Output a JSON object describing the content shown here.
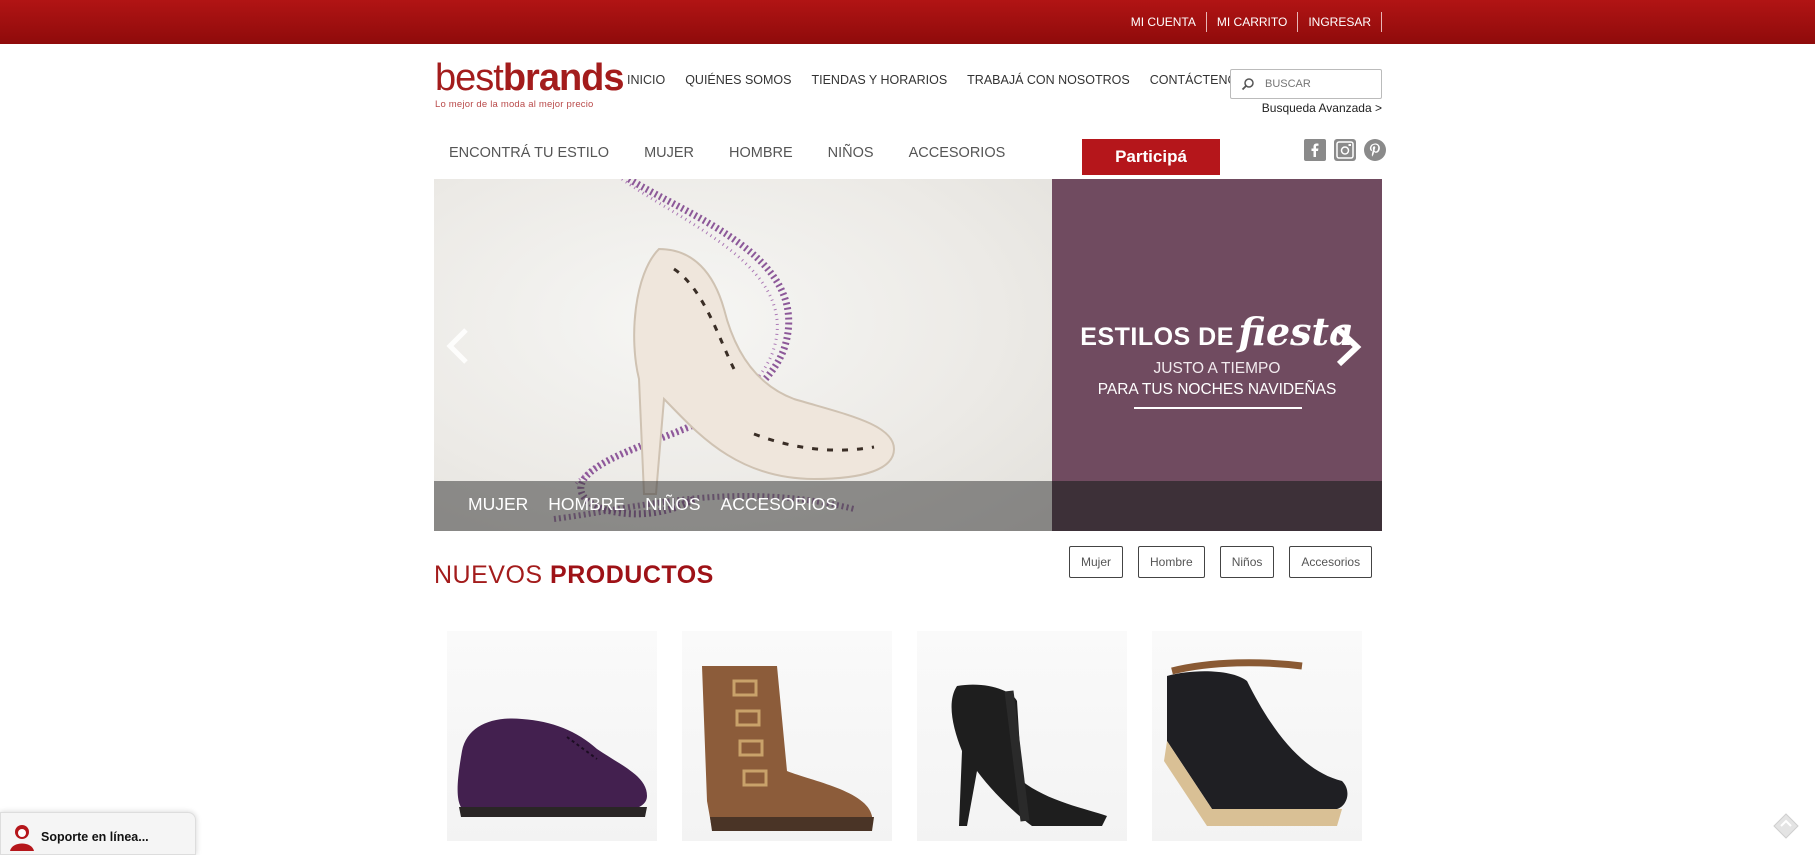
{
  "topbar": {
    "links": [
      "MI CUENTA",
      "MI CARRITO",
      "INGRESAR"
    ]
  },
  "logo": {
    "word_best": "best",
    "word_brands": "brands",
    "tagline": "Lo mejor de la moda al mejor precio"
  },
  "main_nav": [
    "INICIO",
    "QUIÉNES SOMOS",
    "TIENDAS Y HORARIOS",
    "TRABAJÁ CON NOSOTROS",
    "CONTÁCTENOS"
  ],
  "search": {
    "placeholder": "BUSCAR",
    "advanced_label": "Busqueda Avanzada >"
  },
  "category_nav": [
    "ENCONTRÁ TU ESTILO",
    "MUJER",
    "HOMBRE",
    "NIÑOS",
    "ACCESORIOS"
  ],
  "participa_label": "Participá",
  "social_icons": [
    "facebook-icon",
    "instagram-icon",
    "pinterest-icon"
  ],
  "hero": {
    "title_plain": "ESTILOS DE",
    "title_script": "fiesta",
    "subtitle_1": "JUSTO A TIEMPO",
    "subtitle_2": "PARA TUS NOCHES NAVIDEÑAS",
    "categories": [
      "MUJER",
      "HOMBRE",
      "NIÑOS",
      "ACCESORIOS"
    ],
    "panel_color": "#704b60"
  },
  "new_products": {
    "title_light": "NUEVOS ",
    "title_bold": "PRODUCTOS",
    "filters": [
      "Mujer",
      "Hombre",
      "Niños",
      "Accesorios"
    ]
  },
  "support": {
    "label": "Soporte en línea..."
  },
  "colors": {
    "brand_red": "#a31c1c",
    "topbar_red": "#a01010",
    "button_red": "#b5161b"
  }
}
